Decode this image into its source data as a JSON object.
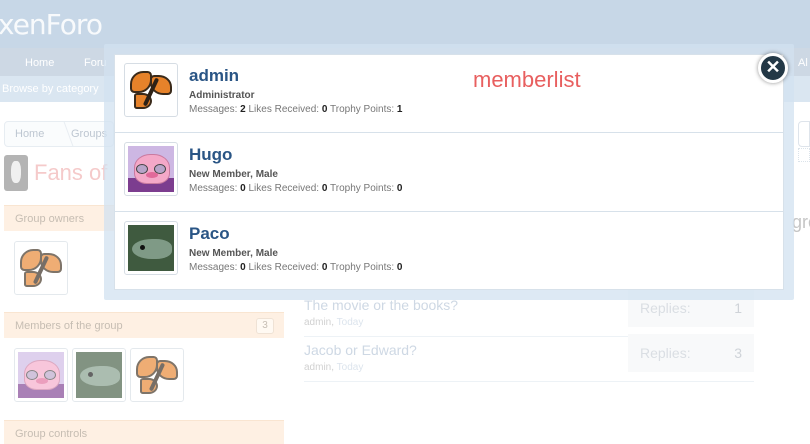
{
  "app": {
    "logo_text": "xenForo"
  },
  "nav": {
    "tabs": [
      "Home",
      "Foru",
      "Al"
    ]
  },
  "subnav": {
    "browse_label": "Browse by category"
  },
  "breadcrumb": [
    "Home",
    "Groups"
  ],
  "page": {
    "title": "Fans of",
    "right_fragment": "gro"
  },
  "sidebar": {
    "owners_label": "Group owners",
    "members_label": "Members of the group",
    "members_count": "3",
    "controls_label": "Group controls"
  },
  "threads": [
    {
      "title": "The movie or the books?",
      "author": "admin",
      "date": "Today",
      "replies_label": "Replies:",
      "replies": "1"
    },
    {
      "title": "Jacob or Edward?",
      "author": "admin",
      "date": "Today",
      "replies_label": "Replies:",
      "replies": "3"
    }
  ],
  "overlay": {
    "title": "memberlist",
    "close_symbol": "✕",
    "members": [
      {
        "name": "admin",
        "role": "Administrator",
        "messages_label": "Messages:",
        "messages": "2",
        "likes_label": "Likes Received:",
        "likes": "0",
        "trophy_label": "Trophy Points:",
        "trophy": "1",
        "avatar": "butterfly-avatar"
      },
      {
        "name": "Hugo",
        "role": "New Member, Male",
        "messages_label": "Messages:",
        "messages": "0",
        "likes_label": "Likes Received:",
        "likes": "0",
        "trophy_label": "Trophy Points:",
        "trophy": "0",
        "avatar": "pig-avatar"
      },
      {
        "name": "Paco",
        "role": "New Member, Male",
        "messages_label": "Messages:",
        "messages": "0",
        "likes_label": "Likes Received:",
        "likes": "0",
        "trophy_label": "Trophy Points:",
        "trophy": "0",
        "avatar": "eel-avatar"
      }
    ]
  },
  "colors": {
    "header_bg": "#a9c2da",
    "member_name": "#2a5585",
    "overlay_title": "#e85f5f",
    "sidebar_head_bg": "#fde9d4"
  }
}
